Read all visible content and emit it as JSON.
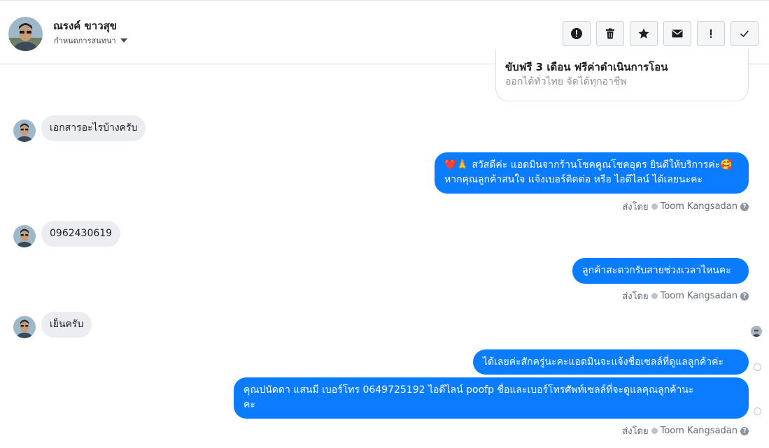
{
  "header": {
    "contact_name": "ณรงค์ ขาวสุข",
    "assign_label": "กำหนดการสนทนา",
    "actions": [
      {
        "icon": "alert-circle-icon",
        "name": "spam-button"
      },
      {
        "icon": "trash-icon",
        "name": "delete-button"
      },
      {
        "icon": "star-icon",
        "name": "star-button"
      },
      {
        "icon": "envelope-icon",
        "name": "mark-unread-button"
      },
      {
        "icon": "exclamation-icon",
        "name": "follow-up-button"
      },
      {
        "icon": "check-icon",
        "name": "mark-done-button"
      }
    ]
  },
  "card": {
    "title": "ขับฟรี 3 เดือน ฟรีค่าดำเนินการโอน",
    "subtitle": "ออกได้ทั่วไทย จัดได้ทุกอาชีพ"
  },
  "messages": [
    {
      "dir": "in",
      "text": "เอกสารอะไรบ้างครับ"
    },
    {
      "dir": "out",
      "line1": "❤️🙏 สวัสดีค่ะ แอดมินจากร้านโชคคูณโชคอุดร ยินดีให้บริการค่ะ🥰",
      "line2": "หากคุณลูกค้าสนใจ แจ้งเบอร์ติดต่อ หรือ ไอดีไลน์ ได้เลยนะคะ"
    },
    {
      "dir": "in",
      "text": "0962430619"
    },
    {
      "dir": "out",
      "text": "ลูกค้าสะดวกรับสายช่วงเวลาไหนคะ"
    },
    {
      "dir": "in",
      "text": "เย็นครับ"
    },
    {
      "dir": "out",
      "text": "ได้เลยค่ะสักครู่นะคะแอดมินจะแจ้งชื่อเซลล์ที่ดูแลลูกค้าค่ะ"
    },
    {
      "dir": "out",
      "line1": "คุณปนัดดา แสนมี   เบอร์โทร 0649725192  ไอดีไลน์ poofp ชื่อและเบอร์โทรศัพท์เซลล์ที่จะดูแลคุณลูกค้านะ",
      "line2": "คะ"
    }
  ],
  "sent_by": {
    "prefix": "ส่งโดย",
    "agent": "Toom Kangsadan"
  },
  "colors": {
    "outgoing_bubble": "#0a7cff",
    "incoming_bubble": "#ebedf0"
  }
}
